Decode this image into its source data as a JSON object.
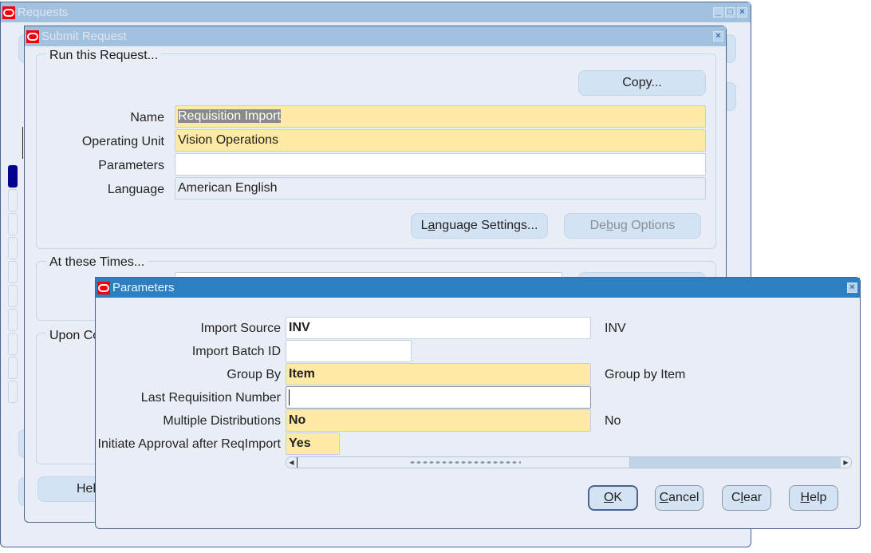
{
  "windows": {
    "requests": {
      "title": "Requests",
      "controls": [
        "minimize-icon",
        "maximize-icon",
        "close-icon"
      ]
    },
    "submit_request": {
      "title": "Submit Request",
      "run_group": {
        "legend": "Run this Request...",
        "copy_button": "Copy...",
        "fields": [
          {
            "label": "Name",
            "value": "Requisition Import",
            "style": "required",
            "selected": true
          },
          {
            "label": "Operating Unit",
            "value": "Vision Operations",
            "style": "required"
          },
          {
            "label": "Parameters",
            "value": "",
            "style": "normal"
          },
          {
            "label": "Language",
            "value": "American English",
            "style": "readonly"
          }
        ],
        "language_settings_button": {
          "pre": "L",
          "mn": "a",
          "post": "nguage Settings..."
        },
        "debug_options_button": {
          "pre": "De",
          "mn": "b",
          "post": "ug Options",
          "disabled": true
        }
      },
      "times_group": {
        "legend": "At these Times..."
      },
      "completion_group": {
        "legend": "Upon Co"
      },
      "help_button": "Hel"
    },
    "parameters": {
      "title": "Parameters",
      "rows": [
        {
          "label": "Import Source",
          "value": "INV",
          "style": "normal",
          "description": "INV"
        },
        {
          "label": "Import Batch ID",
          "value": "",
          "style": "normal",
          "description": ""
        },
        {
          "label": "Group By",
          "value": "Item",
          "style": "required",
          "description": "Group by Item"
        },
        {
          "label": "Last Requisition Number",
          "value": "",
          "style": "normal",
          "description": "",
          "focused": true
        },
        {
          "label": "Multiple Distributions",
          "value": "No",
          "style": "required",
          "description": "No"
        },
        {
          "label": "Initiate Approval after ReqImport",
          "value": "Yes",
          "style": "required",
          "description": ""
        }
      ],
      "buttons": {
        "ok": {
          "mn": "O",
          "post": "K"
        },
        "cancel": {
          "mn": "C",
          "post": "ancel"
        },
        "clear": {
          "pre": "C",
          "mn": "l",
          "post": "ear"
        },
        "help": {
          "mn": "H",
          "post": "elp"
        }
      },
      "scrollbar": {
        "position_percent": 0
      }
    }
  },
  "colors": {
    "required": "#feeaa5",
    "active_title": "#2c80c1",
    "inactive_title": "#a2c1de",
    "oracle_red": "#f3000c"
  }
}
